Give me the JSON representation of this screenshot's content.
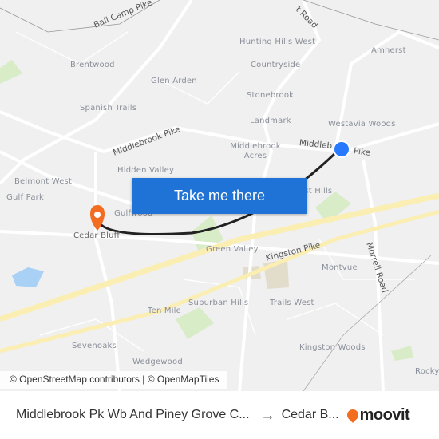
{
  "map": {
    "places": [
      "Hunting Hills West",
      "Amherst",
      "Brentwood",
      "Countryside",
      "Glen Arden",
      "Stonebrook",
      "Spanish Trails",
      "Landmark",
      "Westavia Woods",
      "Middlebrook Acres",
      "Hidden Valley",
      "Belmont West",
      "Gulf Park",
      "Gulfwood",
      "Cedar Bluff",
      "Green Valley",
      "Montvue",
      "Suburban Hills",
      "Trails West",
      "Ten Mile",
      "Sevenoaks",
      "Kingston Woods",
      "Wedgewood",
      "Rocky",
      "est Hills"
    ],
    "roads": [
      "Ball Camp Pike",
      "Middlebrook Pike",
      "Middleb",
      "Pike",
      "Kingston Pike",
      "Morrell Road",
      "t Road"
    ],
    "origin_color": "#2979ff",
    "destination_color": "#f36d21",
    "route_color": "#222222"
  },
  "cta": {
    "label": "Take me there"
  },
  "attribution": "© OpenStreetMap contributors | © OpenMapTiles",
  "footer": {
    "origin": "Middlebrook Pk Wb And Piney Grove C...",
    "arrow": "→",
    "destination": "Cedar B...",
    "brand": "moovit"
  }
}
